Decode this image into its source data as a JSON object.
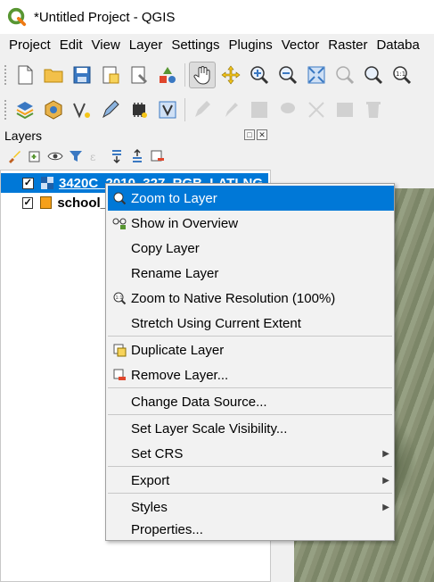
{
  "window": {
    "title": "*Untitled Project - QGIS"
  },
  "menubar": [
    "Project",
    "Edit",
    "View",
    "Layer",
    "Settings",
    "Plugins",
    "Vector",
    "Raster",
    "Databa"
  ],
  "panel": {
    "title": "Layers"
  },
  "layers": [
    {
      "name": "3420C_2010_327_RGB_LATLNG",
      "checked": true,
      "selected": true,
      "symbol": "raster",
      "color": "#1f5fa8"
    },
    {
      "name": "school_",
      "checked": true,
      "selected": false,
      "symbol": "polygon",
      "color": "#f5a01a"
    }
  ],
  "context_menu": {
    "items": [
      {
        "label": "Zoom to Layer",
        "icon": "zoom-layer-icon",
        "highlighted": true
      },
      {
        "label": "Show in Overview",
        "icon": "overview-icon"
      },
      {
        "label": "Copy Layer"
      },
      {
        "label": "Rename Layer"
      },
      {
        "label": "Zoom to Native Resolution (100%)",
        "icon": "zoom-native-icon"
      },
      {
        "label": "Stretch Using Current Extent"
      },
      {
        "label": "Duplicate Layer",
        "icon": "duplicate-icon"
      },
      {
        "label": "Remove Layer...",
        "icon": "remove-icon"
      },
      {
        "label": "Change Data Source..."
      },
      {
        "label": "Set Layer Scale Visibility..."
      },
      {
        "label": "Set CRS",
        "submenu": true
      },
      {
        "label": "Export",
        "submenu": true
      },
      {
        "label": "Styles",
        "submenu": true
      },
      {
        "label": "Properties..."
      }
    ]
  },
  "colors": {
    "accent": "#0078d7",
    "qgis_green": "#589632",
    "qgis_yellow": "#ee7913"
  }
}
